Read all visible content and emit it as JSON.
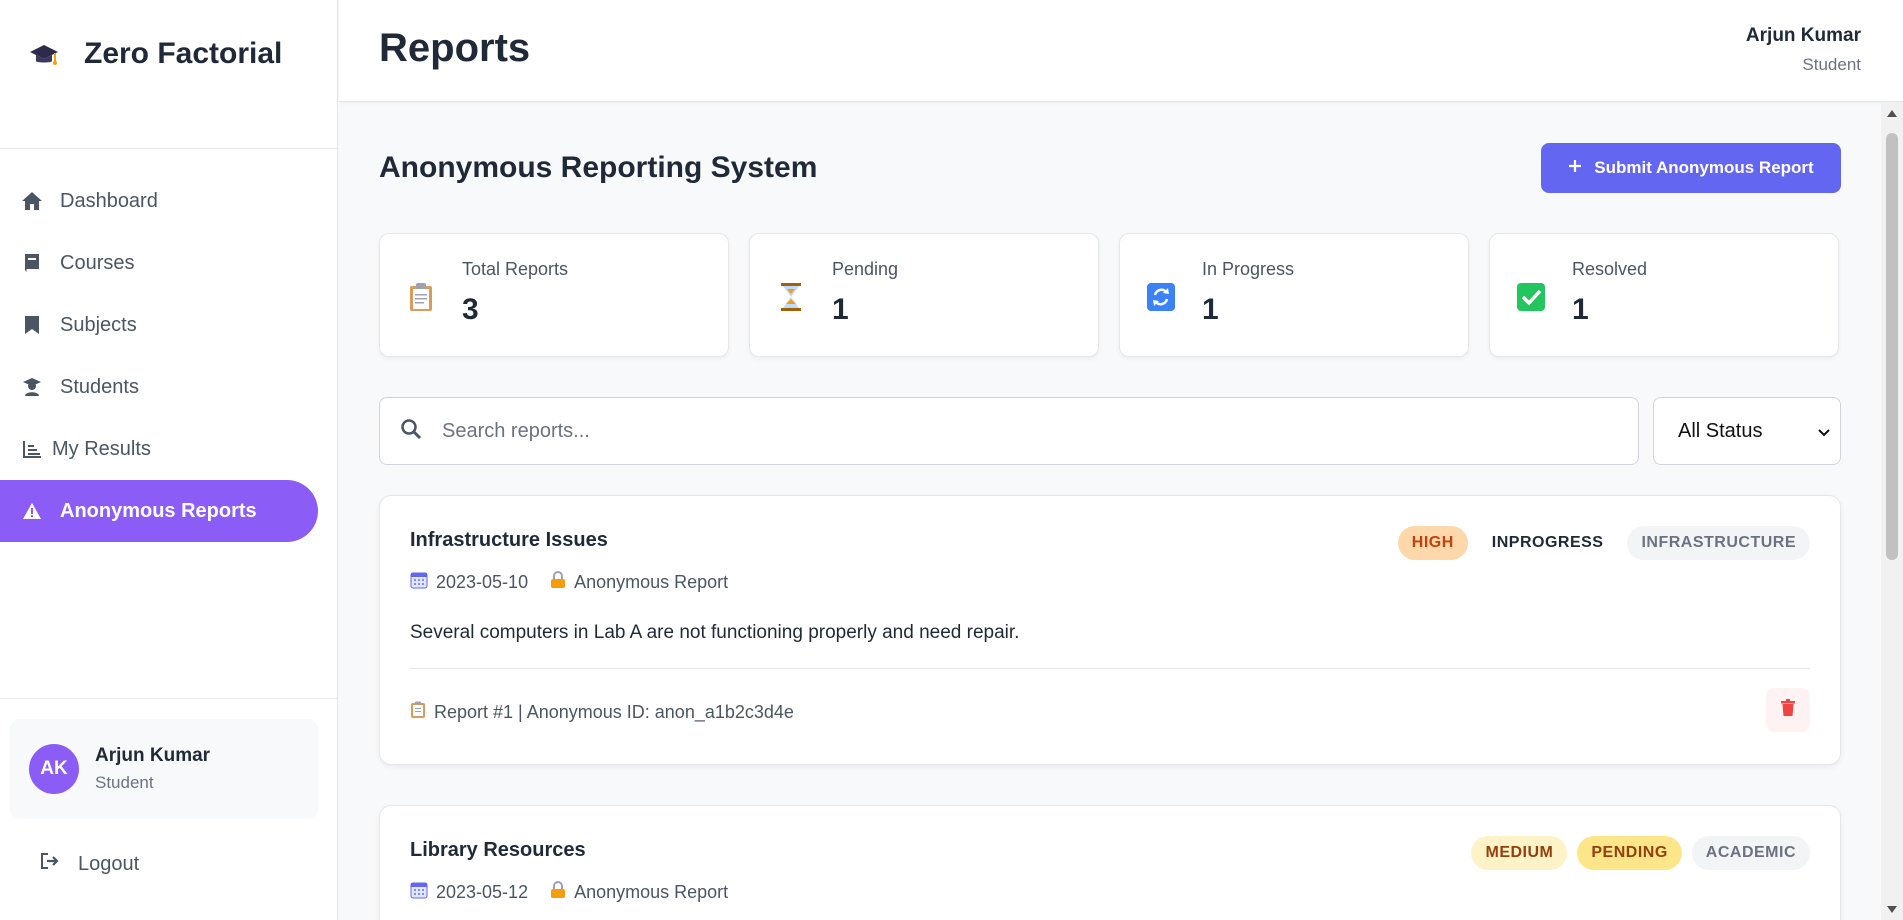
{
  "app": {
    "brand": "Zero Factorial"
  },
  "sidebar": {
    "items": [
      {
        "label": "Dashboard",
        "icon": "home-icon"
      },
      {
        "label": "Courses",
        "icon": "book-icon"
      },
      {
        "label": "Subjects",
        "icon": "bookmark-icon"
      },
      {
        "label": "Students",
        "icon": "graduate-icon"
      },
      {
        "label": "My Results",
        "icon": "chart-icon"
      },
      {
        "label": "Anonymous Reports",
        "icon": "warning-icon",
        "active": true
      }
    ],
    "user": {
      "initials": "AK",
      "name": "Arjun Kumar",
      "role": "Student"
    },
    "logout_label": "Logout"
  },
  "header": {
    "title": "Reports",
    "user_name": "Arjun Kumar",
    "user_role": "Student"
  },
  "main": {
    "section_title": "Anonymous Reporting System",
    "submit_label": "Submit Anonymous Report",
    "stats": [
      {
        "label": "Total Reports",
        "value": "3",
        "icon": "clipboard-icon"
      },
      {
        "label": "Pending",
        "value": "1",
        "icon": "hourglass-icon"
      },
      {
        "label": "In Progress",
        "value": "1",
        "icon": "refresh-icon"
      },
      {
        "label": "Resolved",
        "value": "1",
        "icon": "check-icon"
      }
    ],
    "search": {
      "placeholder": "Search reports..."
    },
    "status_filter": {
      "selected": "All Status"
    },
    "reports": [
      {
        "title": "Infrastructure Issues",
        "priority": "HIGH",
        "status": "INPROGRESS",
        "category": "INFRASTRUCTURE",
        "date": "2023-05-10",
        "visibility": "Anonymous Report",
        "description": "Several computers in Lab A are not functioning properly and need repair.",
        "footer": "Report #1 | Anonymous ID: anon_a1b2c3d4e"
      },
      {
        "title": "Library Resources",
        "priority": "MEDIUM",
        "status": "PENDING",
        "category": "ACADEMIC",
        "date": "2023-05-12",
        "visibility": "Anonymous Report"
      }
    ]
  },
  "colors": {
    "accent": "#8b5cf6",
    "button": "#6366f1",
    "danger": "#ef4444"
  }
}
